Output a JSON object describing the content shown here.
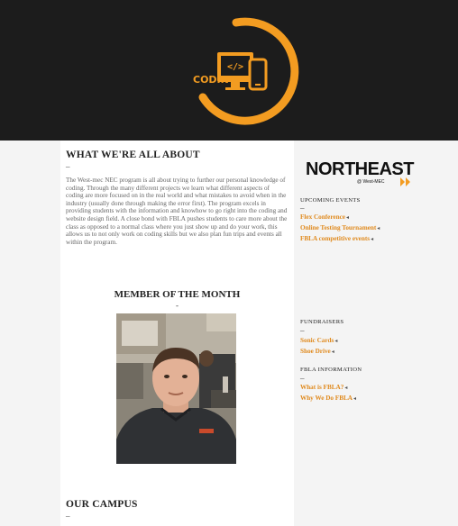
{
  "header": {
    "logo_text": "CODING",
    "brand_color": "#f39c21"
  },
  "main": {
    "about_title": "WHAT WE'RE ALL ABOUT",
    "divider": "–",
    "about_text": "The West-mec NEC program is all about trying to further our personal knowledge of coding. Through the many different projects we learn what different aspects of coding are more focused on in the real world and what mistakes to avoid when in the industry (usually done through making the error first). The program excels in providing students with the information and knowhow to go right into the coding and website design field. A close bond with FBLA pushes students to care more about the class as opposed to a normal class where you just show up and do your work, this allows us to not only work on coding skills but we also plan fun trips and events all within the program.",
    "member_title": "MEMBER OF THE MONTH",
    "member_divider": "-",
    "campus_title": "OUR CAMPUS",
    "campus_divider": "–"
  },
  "sidebar": {
    "logo_main": "NORTHEAST",
    "logo_sub": "@ West-MEC",
    "upcoming_title": "UPCOMING EVENTS",
    "upcoming_divider": "–",
    "upcoming": [
      "Flex Conference",
      "Online Testing Tournament",
      "FBLA competitive events"
    ],
    "fund_title": "FUNDRAISERS",
    "fund_divider": "–",
    "fundraisers": [
      "Sonic Cards",
      "Shoe Drive"
    ],
    "fbla_title": "FBLA INFORMATION",
    "fbla_divider": "–",
    "fbla": [
      "What is FBLA?",
      "Why We Do FBLA"
    ],
    "arrow": "◂",
    "link_color": "#e08a1e"
  }
}
